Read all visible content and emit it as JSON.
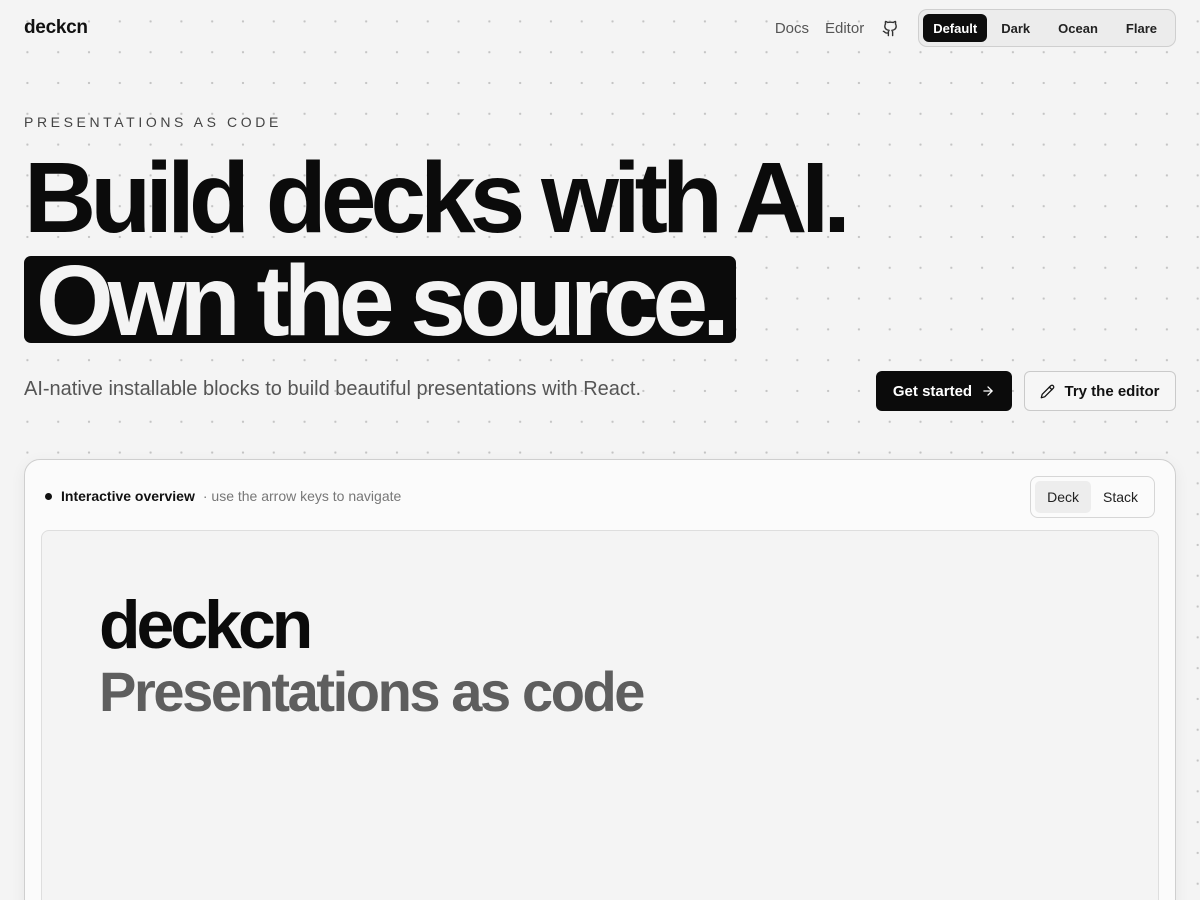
{
  "nav": {
    "logo": "deckcn",
    "links": [
      "Docs",
      "Editor"
    ],
    "themes": [
      "Default",
      "Dark",
      "Ocean",
      "Flare"
    ],
    "active_theme": "Default"
  },
  "hero": {
    "eyebrow": "PRESENTATIONS AS CODE",
    "headline_1": "Build decks with AI.",
    "headline_2": "Own the source.",
    "subline": "AI-native installable blocks to build beautiful presentations with React.",
    "primary_button": "Get started",
    "secondary_button": "Try the editor"
  },
  "overview": {
    "title": "Interactive overview",
    "hint": "· use the arrow keys to navigate",
    "views": [
      "Deck",
      "Stack"
    ],
    "active_view": "Deck",
    "slide": {
      "title": "deckcn",
      "subtitle": "Presentations as code"
    }
  },
  "colors": {
    "background": "#f4f4f4",
    "ink": "#0b0b0b",
    "muted": "#555555"
  }
}
